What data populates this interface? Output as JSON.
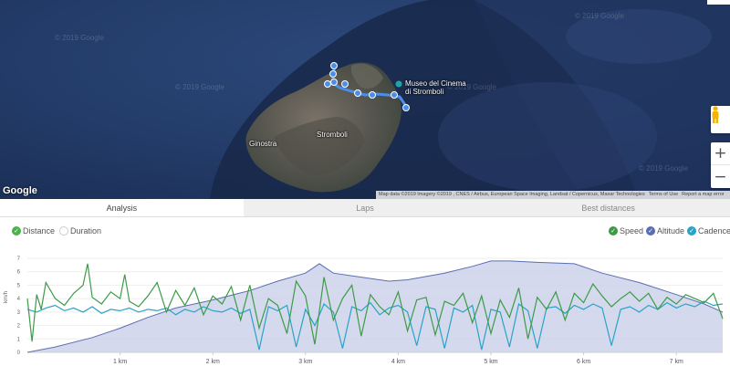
{
  "map": {
    "labels": {
      "museum": "Museo del Cinema\ndi Stromboli",
      "stromboli": "Stromboli",
      "ginostra": "Ginostra"
    },
    "watermarks": [
      "© 2019 Google",
      "© 2019 Google",
      "© 2019 Google",
      "© 2019 Google",
      "© 2019 Google"
    ],
    "google_logo": "Google",
    "attribution": {
      "map_data": "Map data ©2019 Imagery ©2019 , CNES / Airbus, European Space Imaging, Landsat / Copernicus, Maxar Technologies",
      "terms": "Terms of Use",
      "report": "Report a map error"
    },
    "zoom_in": "+",
    "zoom_out": "−",
    "route_points": 10
  },
  "tabs": [
    {
      "label": "Analysis",
      "active": true
    },
    {
      "label": "Laps",
      "active": false
    },
    {
      "label": "Best distances",
      "active": false
    }
  ],
  "toggles_left": [
    {
      "label": "Distance",
      "checked": true,
      "color": "#4caf50"
    },
    {
      "label": "Duration",
      "checked": false,
      "color": "#cccccc"
    }
  ],
  "toggles_right": [
    {
      "label": "Speed",
      "checked": true,
      "color": "#3d9b47"
    },
    {
      "label": "Altitude",
      "checked": true,
      "color": "#5a6fb0"
    },
    {
      "label": "Cadence",
      "checked": true,
      "color": "#29a3c7"
    }
  ],
  "chart_data": {
    "type": "line",
    "x_unit": "km",
    "y_label": "km/h",
    "x_ticks": [
      "1 km",
      "2 km",
      "3 km",
      "4 km",
      "5 km",
      "6 km",
      "7 km"
    ],
    "x_tick_values": [
      1,
      2,
      3,
      4,
      5,
      6,
      7
    ],
    "xlim": [
      0,
      7.5
    ],
    "y_ticks": [
      "0",
      "1",
      "2",
      "3",
      "4",
      "5",
      "6",
      "7"
    ],
    "ylim": [
      0,
      7
    ],
    "colors": {
      "speed": "#3d9b47",
      "altitude_fill": "#cdd2ea",
      "altitude_line": "#5a6fb0",
      "cadence": "#29a3c7"
    },
    "series": [
      {
        "name": "Altitude",
        "x": [
          0,
          0.3,
          0.7,
          1.0,
          1.3,
          1.6,
          2.0,
          2.4,
          2.7,
          3.0,
          3.15,
          3.3,
          3.6,
          3.9,
          4.1,
          4.5,
          4.8,
          5.0,
          5.2,
          5.5,
          5.9,
          6.2,
          6.6,
          7.0,
          7.3,
          7.5
        ],
        "values": [
          0,
          0.4,
          1.1,
          1.8,
          2.6,
          3.3,
          3.9,
          4.6,
          5.3,
          5.9,
          6.6,
          5.9,
          5.6,
          5.3,
          5.4,
          5.9,
          6.4,
          6.8,
          6.8,
          6.7,
          6.6,
          5.9,
          5.2,
          4.3,
          3.6,
          3.0
        ]
      },
      {
        "name": "Speed",
        "x": [
          0.0,
          0.05,
          0.1,
          0.15,
          0.2,
          0.3,
          0.4,
          0.5,
          0.6,
          0.65,
          0.7,
          0.8,
          0.9,
          1.0,
          1.05,
          1.1,
          1.2,
          1.3,
          1.4,
          1.5,
          1.6,
          1.7,
          1.8,
          1.9,
          2.0,
          2.1,
          2.2,
          2.3,
          2.4,
          2.5,
          2.6,
          2.7,
          2.8,
          2.9,
          3.0,
          3.1,
          3.2,
          3.3,
          3.4,
          3.5,
          3.6,
          3.7,
          3.8,
          3.9,
          4.0,
          4.1,
          4.2,
          4.3,
          4.4,
          4.5,
          4.6,
          4.7,
          4.8,
          4.9,
          5.0,
          5.1,
          5.2,
          5.3,
          5.4,
          5.5,
          5.6,
          5.7,
          5.8,
          5.9,
          6.0,
          6.1,
          6.2,
          6.3,
          6.4,
          6.5,
          6.6,
          6.7,
          6.8,
          6.9,
          7.0,
          7.1,
          7.2,
          7.3,
          7.4,
          7.5
        ],
        "values": [
          4.0,
          0.8,
          4.3,
          3.2,
          5.2,
          4.0,
          3.5,
          4.4,
          5.0,
          6.6,
          4.1,
          3.6,
          4.5,
          4.0,
          5.8,
          3.8,
          3.4,
          4.2,
          5.2,
          3.0,
          4.6,
          3.5,
          4.8,
          2.8,
          4.2,
          3.6,
          4.9,
          2.4,
          5.0,
          1.8,
          4.0,
          3.5,
          1.4,
          5.3,
          4.2,
          0.6,
          5.6,
          2.4,
          4.0,
          5.0,
          1.2,
          4.3,
          3.4,
          2.8,
          4.5,
          1.6,
          3.9,
          4.1,
          1.3,
          3.8,
          3.5,
          4.4,
          2.2,
          4.2,
          1.4,
          3.9,
          2.6,
          4.8,
          1.0,
          4.1,
          3.2,
          4.5,
          2.4,
          4.4,
          3.7,
          5.1,
          4.2,
          3.4,
          4.0,
          4.5,
          3.8,
          4.4,
          3.2,
          4.1,
          3.6,
          4.3,
          4.0,
          3.7,
          4.4,
          2.5
        ]
      },
      {
        "name": "Cadence",
        "x": [
          0.0,
          0.1,
          0.2,
          0.3,
          0.4,
          0.5,
          0.6,
          0.7,
          0.8,
          0.9,
          1.0,
          1.1,
          1.2,
          1.3,
          1.4,
          1.5,
          1.6,
          1.7,
          1.8,
          1.9,
          2.0,
          2.1,
          2.2,
          2.3,
          2.4,
          2.5,
          2.6,
          2.7,
          2.8,
          2.9,
          3.0,
          3.1,
          3.2,
          3.3,
          3.4,
          3.5,
          3.6,
          3.7,
          3.8,
          3.9,
          4.0,
          4.1,
          4.2,
          4.3,
          4.4,
          4.5,
          4.6,
          4.7,
          4.8,
          4.9,
          5.0,
          5.1,
          5.2,
          5.3,
          5.4,
          5.5,
          5.6,
          5.7,
          5.8,
          5.9,
          6.0,
          6.1,
          6.2,
          6.3,
          6.4,
          6.5,
          6.6,
          6.7,
          6.8,
          6.9,
          7.0,
          7.1,
          7.2,
          7.3,
          7.4,
          7.5
        ],
        "values": [
          3.2,
          3.0,
          3.3,
          3.5,
          3.1,
          3.3,
          3.0,
          3.4,
          2.9,
          3.2,
          3.1,
          3.3,
          3.0,
          3.2,
          3.1,
          3.3,
          2.8,
          3.2,
          3.0,
          3.4,
          3.1,
          3.0,
          3.3,
          2.9,
          3.2,
          0.2,
          3.4,
          3.1,
          3.5,
          0.4,
          3.2,
          2.0,
          3.6,
          3.0,
          0.3,
          3.4,
          3.1,
          3.7,
          2.8,
          3.3,
          3.5,
          3.0,
          0.5,
          3.4,
          3.2,
          0.3,
          3.3,
          3.0,
          3.5,
          0.2,
          3.2,
          3.0,
          0.4,
          3.6,
          3.1,
          0.3,
          3.3,
          3.4,
          2.9,
          3.5,
          3.2,
          3.6,
          3.3,
          0.5,
          3.2,
          3.4,
          3.0,
          3.5,
          3.2,
          3.7,
          3.3,
          3.6,
          3.4,
          3.8,
          3.5,
          3.6
        ]
      }
    ],
    "grid": true,
    "legend": "top-right"
  }
}
